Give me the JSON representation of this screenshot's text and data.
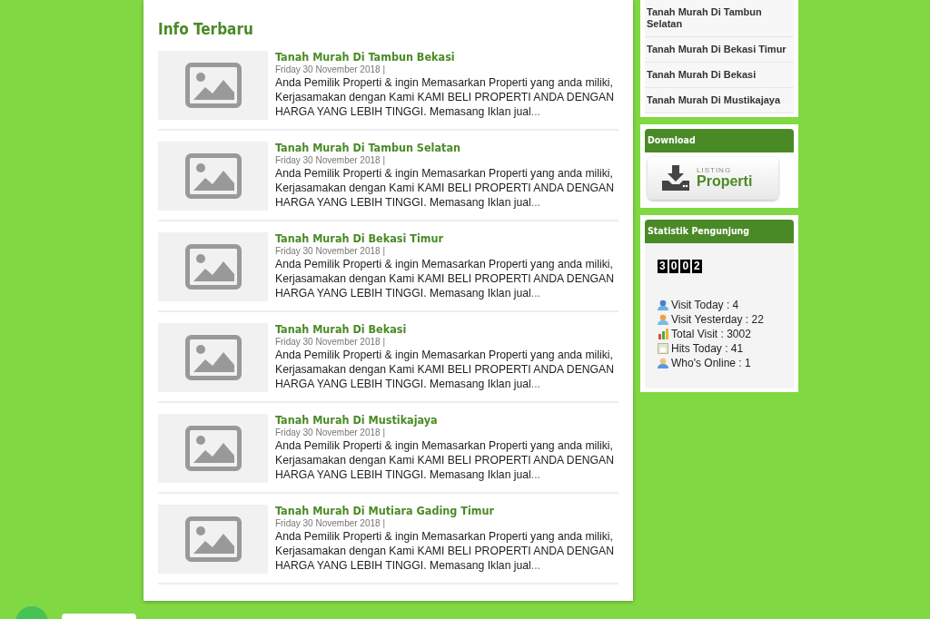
{
  "main": {
    "title": "Info Terbaru",
    "posts": [
      {
        "title": "Tanah Murah Di Tambun Bekasi",
        "date": "Friday 30 November 2018 |",
        "excerpt": "Anda Pemilik Properti & ingin Memasarkan Properti yang anda miliki, Kerjasamakan dengan Kami KAMI BELI PROPERTI ANDA DENGAN HARGA YANG LEBIH TINGGI. Memasang Iklan jual",
        "more": "..."
      },
      {
        "title": "Tanah Murah Di Tambun Selatan",
        "date": "Friday 30 November 2018 |",
        "excerpt": "Anda Pemilik Properti & ingin Memasarkan Properti yang anda miliki, Kerjasamakan dengan Kami KAMI BELI PROPERTI ANDA DENGAN HARGA YANG LEBIH TINGGI. Memasang Iklan jual",
        "more": "..."
      },
      {
        "title": "Tanah Murah Di Bekasi Timur",
        "date": "Friday 30 November 2018 |",
        "excerpt": "Anda Pemilik Properti & ingin Memasarkan Properti yang anda miliki, Kerjasamakan dengan Kami KAMI BELI PROPERTI ANDA DENGAN HARGA YANG LEBIH TINGGI. Memasang Iklan jual",
        "more": "..."
      },
      {
        "title": "Tanah Murah Di Bekasi",
        "date": "Friday 30 November 2018 |",
        "excerpt": "Anda Pemilik Properti & ingin Memasarkan Properti yang anda miliki, Kerjasamakan dengan Kami KAMI BELI PROPERTI ANDA DENGAN HARGA YANG LEBIH TINGGI. Memasang Iklan jual",
        "more": "..."
      },
      {
        "title": "Tanah Murah Di Mustikajaya",
        "date": "Friday 30 November 2018 |",
        "excerpt": "Anda Pemilik Properti & ingin Memasarkan Properti yang anda miliki, Kerjasamakan dengan Kami KAMI BELI PROPERTI ANDA DENGAN HARGA YANG LEBIH TINGGI. Memasang Iklan jual",
        "more": "..."
      },
      {
        "title": "Tanah Murah Di Mutiara Gading Timur",
        "date": "Friday 30 November 2018 |",
        "excerpt": "Anda Pemilik Properti & ingin Memasarkan Properti yang anda miliki, Kerjasamakan dengan Kami KAMI BELI PROPERTI ANDA DENGAN HARGA YANG LEBIH TINGGI. Memasang Iklan jual",
        "more": "..."
      }
    ]
  },
  "sidebar": {
    "links": [
      "Tanah Murah Di Tambun Selatan",
      "Tanah Murah Di Bekasi Timur",
      "Tanah Murah Di Bekasi",
      "Tanah Murah Di Mustikajaya"
    ],
    "download": {
      "title": "Download",
      "banner_small": "LISTING",
      "banner_big": "Properti"
    },
    "stats": {
      "title": "Statistik Pengunjung",
      "digits": [
        "3",
        "0",
        "0",
        "2"
      ],
      "lines": [
        {
          "kind": "today",
          "text": "Visit Today : 4"
        },
        {
          "kind": "yesterday",
          "text": "Visit Yesterday : 22"
        },
        {
          "kind": "total",
          "text": "Total Visit : 3002"
        },
        {
          "kind": "hits",
          "text": "Hits Today : 41"
        },
        {
          "kind": "online",
          "text": "Who's Online : 1"
        }
      ]
    }
  }
}
